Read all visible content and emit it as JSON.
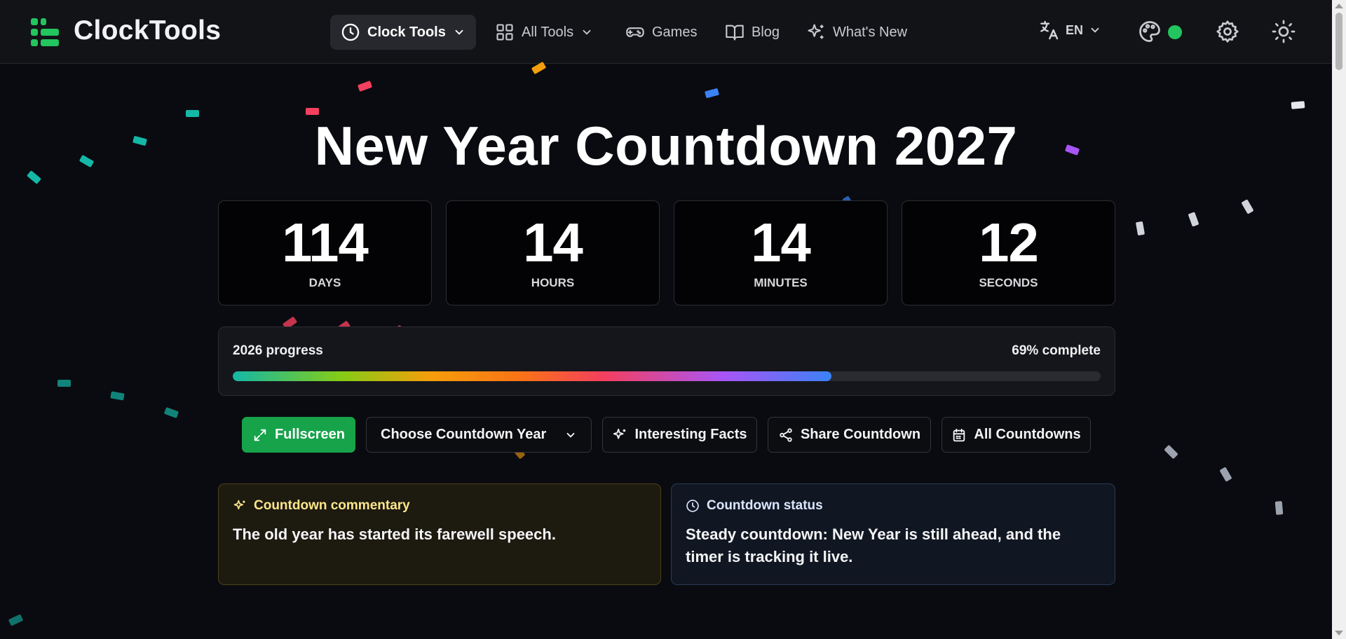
{
  "header": {
    "brand": "ClockTools",
    "nav": [
      {
        "label": "Clock Tools",
        "icon": "clock-icon",
        "active": true
      },
      {
        "label": "All Tools",
        "icon": "grid-icon"
      },
      {
        "label": "Games",
        "icon": "gamepad-icon"
      },
      {
        "label": "Blog",
        "icon": "book-icon"
      },
      {
        "label": "What's New",
        "icon": "sparkles-icon"
      }
    ],
    "language": "EN",
    "theme_color": "#22c55e"
  },
  "countdown": {
    "title": "New Year Countdown 2027",
    "units": [
      {
        "value": "114",
        "label": "DAYS"
      },
      {
        "value": "14",
        "label": "HOURS"
      },
      {
        "value": "14",
        "label": "MINUTES"
      },
      {
        "value": "12",
        "label": "SECONDS"
      }
    ]
  },
  "progress": {
    "label": "2026 progress",
    "status": "69% complete",
    "percent": 69
  },
  "actions": {
    "fullscreen": "Fullscreen",
    "year_select": "Choose Countdown Year",
    "facts": "Interesting Facts",
    "share": "Share Countdown",
    "all": "All Countdowns"
  },
  "commentary": {
    "title": "Countdown commentary",
    "text": "The old year has started its farewell speech."
  },
  "status": {
    "title": "Countdown status",
    "text": "Steady countdown: New Year is still ahead, and the timer is tracking it live."
  },
  "colors": {
    "accent": "#22c55e",
    "background": "#0a0b10"
  }
}
